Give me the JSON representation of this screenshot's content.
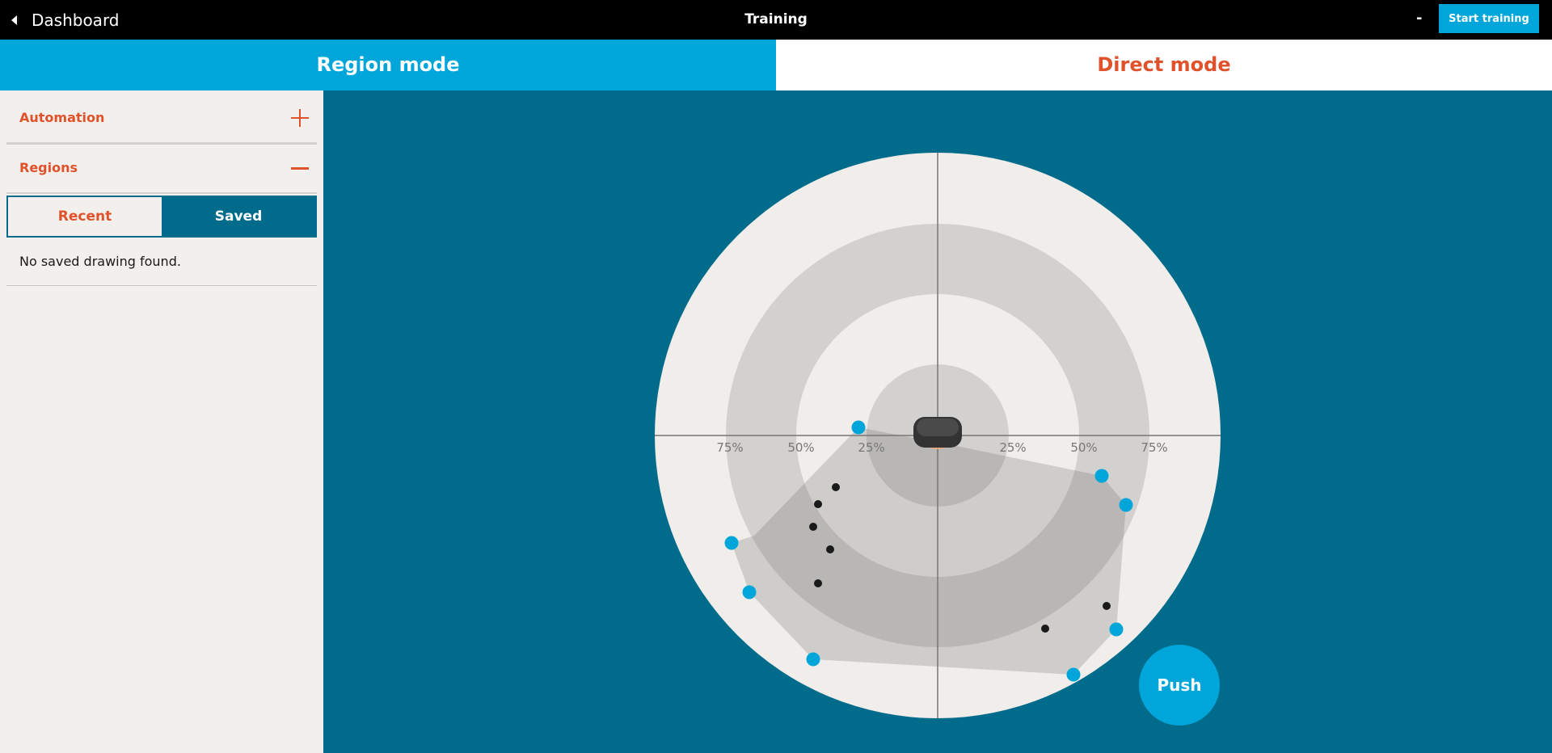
{
  "topbar": {
    "back_label": "Dashboard",
    "title": "Training",
    "minimize_label": "-",
    "start_label": "Start training"
  },
  "modes": {
    "region": "Region mode",
    "direct": "Direct mode"
  },
  "sidebar": {
    "automation_label": "Automation",
    "regions_label": "Regions",
    "tab_recent": "Recent",
    "tab_saved": "Saved",
    "empty_message": "No saved drawing found."
  },
  "radar": {
    "ring_labels_left": [
      "75%",
      "50%",
      "25%"
    ],
    "ring_labels_right": [
      "25%",
      "50%",
      "75%"
    ],
    "push_label": "Push"
  },
  "colors": {
    "accent_blue": "#00a6d9",
    "dark_teal": "#006b8a",
    "orange": "#e0522b"
  }
}
